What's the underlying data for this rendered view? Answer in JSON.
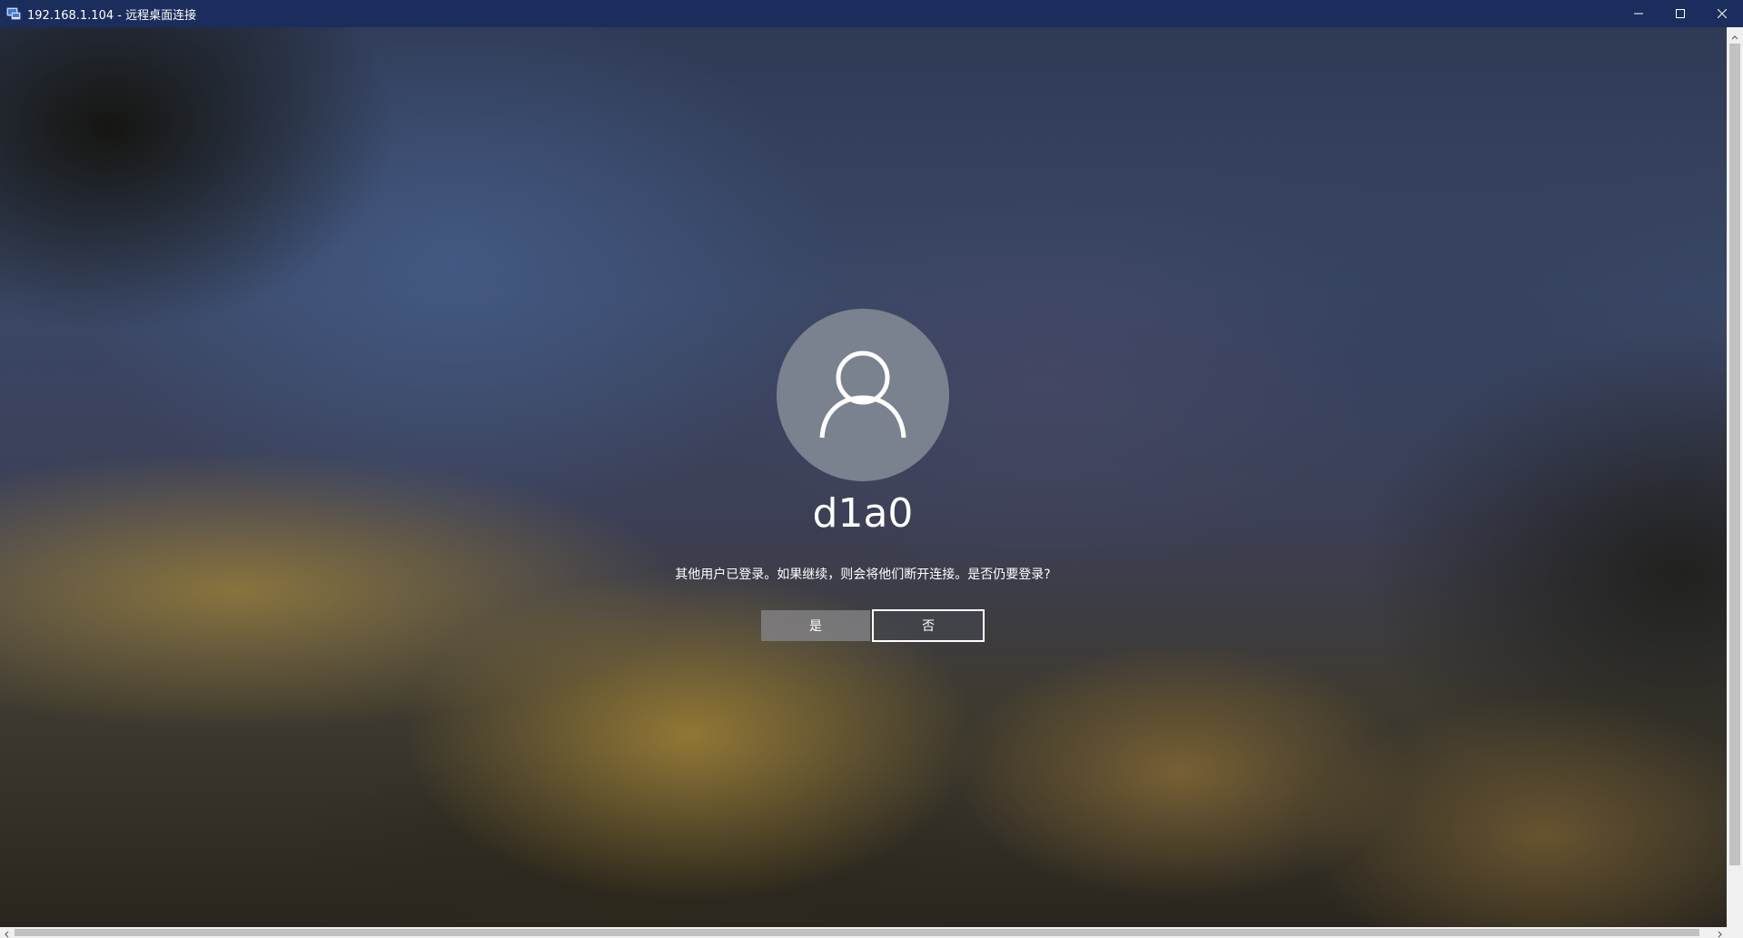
{
  "window": {
    "title": "192.168.1.104 - 远程桌面连接",
    "app_icon": "remote-desktop-icon",
    "controls": {
      "minimize_icon": "minimize-icon",
      "maximize_icon": "maximize-icon",
      "close_icon": "close-icon"
    }
  },
  "login": {
    "avatar_icon": "user-silhouette-icon",
    "username": "d1a0",
    "message": "其他用户已登录。如果继续，则会将他们断开连接。是否仍要登录?",
    "yes_label": "是",
    "no_label": "否"
  },
  "colors": {
    "titlebar": "#1b2d5c",
    "avatar": "#7a818f",
    "text": "#ffffff"
  }
}
